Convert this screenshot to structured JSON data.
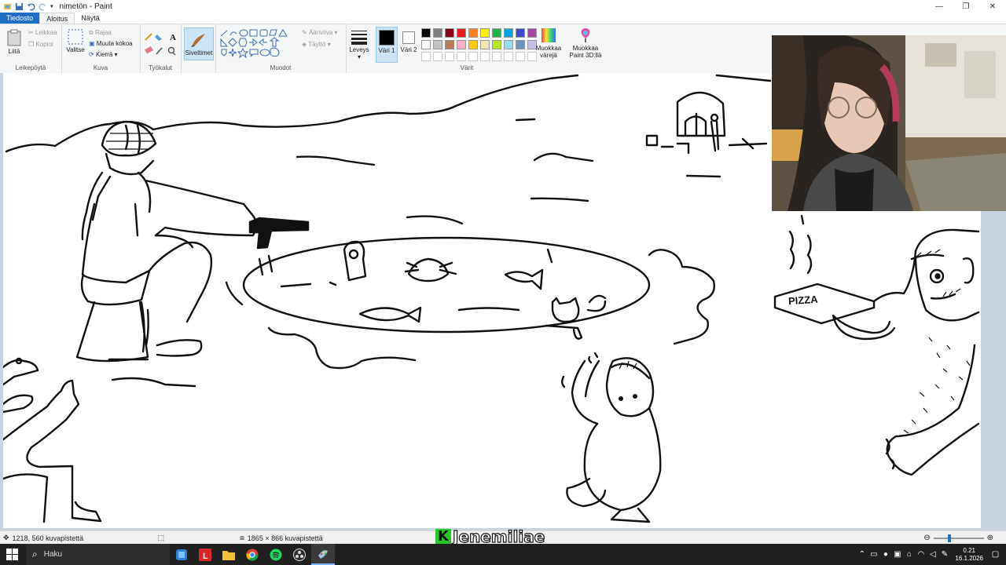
{
  "window": {
    "title": "nimetön - Paint",
    "minimize": "—",
    "maximize": "❐",
    "close": "✕"
  },
  "tabs": [
    "Tiedosto",
    "Aloitus",
    "Näytä"
  ],
  "ribbon": {
    "clipboard": {
      "paste": "Liitä",
      "cut": "Leikkaa",
      "copy": "Kopioi",
      "label": "Leikepöytä"
    },
    "image": {
      "select": "Valitse",
      "crop": "Rajaa",
      "resize": "Muuta kokoa",
      "rotate": "Kierrä",
      "label": "Kuva"
    },
    "tools": {
      "label": "Työkalut"
    },
    "brushes": {
      "label": "Siveltimet"
    },
    "shapes": {
      "outline": "Ääriviiva",
      "fill": "Täyttö",
      "label": "Muodot"
    },
    "size": {
      "label": "Leveys"
    },
    "colors": {
      "color1": "Väri 1",
      "color2": "Väri 2",
      "edit": "Muokkaa värejä",
      "paint3d": "Muokkaa Paint 3D:llä",
      "label": "Värit",
      "row1": [
        "#000000",
        "#7f7f7f",
        "#880015",
        "#ed1c24",
        "#ff7f27",
        "#fff200",
        "#22b14c",
        "#00a2e8",
        "#3f48cc",
        "#a349a4"
      ],
      "row2": [
        "#ffffff",
        "#c3c3c3",
        "#b97a57",
        "#ffaec9",
        "#ffc90e",
        "#efe4b0",
        "#b5e61d",
        "#99d9ea",
        "#7092be",
        "#c8bfe7"
      ]
    }
  },
  "drawing": {
    "pizza_label": "PIZZA"
  },
  "status": {
    "cursor": "1218, 560 kuvapistettä",
    "size": "1865 × 866 kuvapistettä"
  },
  "overlay": {
    "logo": "K",
    "name": "Jenemiliae"
  },
  "taskbar": {
    "search": "Haku",
    "time": "0.21",
    "date": "16.1.2026"
  }
}
